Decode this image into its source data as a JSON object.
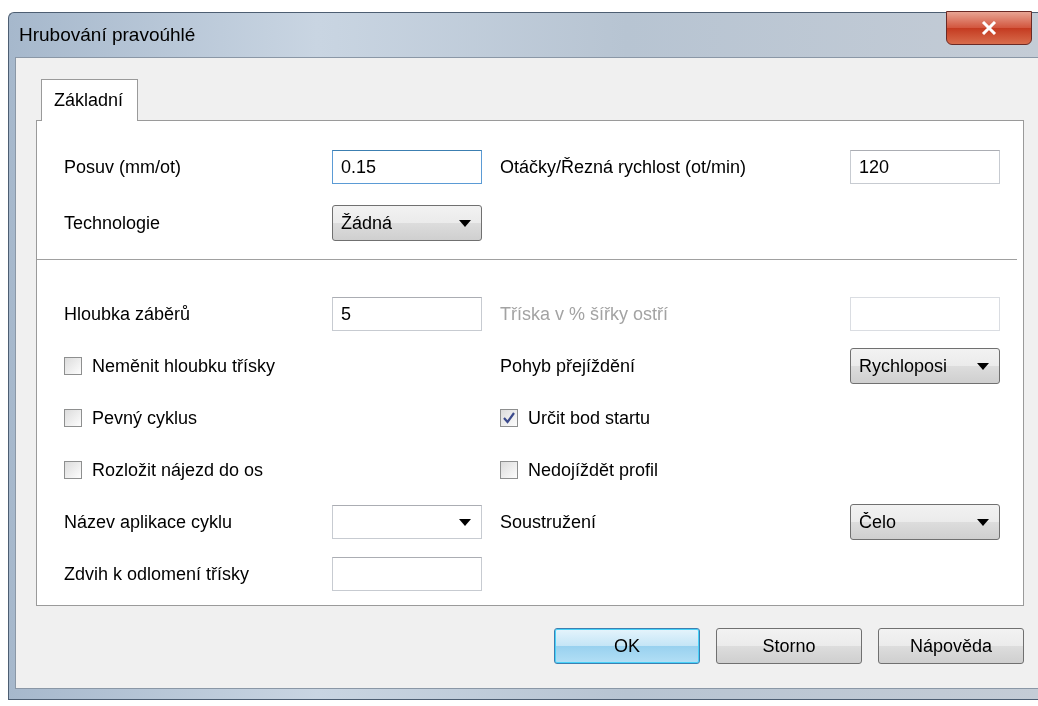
{
  "window": {
    "title": "Hrubování pravoúhlé"
  },
  "tabs": [
    {
      "label": "Základní",
      "selected": true
    }
  ],
  "sections": [
    {
      "rows": [
        [
          {
            "kind": "text",
            "label": "Posuv (mm/ot)",
            "value": "0.15",
            "focused": true,
            "disabled": false
          },
          {
            "kind": "text",
            "label": "Otáčky/Řezná rychlost (ot/min)",
            "value": "120",
            "focused": false,
            "disabled": false
          }
        ],
        [
          {
            "kind": "dropdown",
            "label": "Technologie",
            "value": "Žádná",
            "editable": false
          }
        ]
      ]
    },
    {
      "rows": [
        [
          {
            "kind": "text",
            "label": "Hloubka záběrů",
            "value": "5",
            "focused": false,
            "disabled": false
          },
          {
            "kind": "text",
            "label": "Tříska v % šířky ostří",
            "focused": false,
            "disabled": true
          }
        ],
        [
          {
            "kind": "checkbox",
            "label": "Neměnit hloubku třísky",
            "checked": false
          },
          {
            "kind": "dropdown",
            "label": "Pohyb přejíždění",
            "value": "Rychloposi",
            "editable": false
          }
        ],
        [
          {
            "kind": "checkbox",
            "label": "Pevný cyklus",
            "checked": false
          },
          {
            "kind": "checkbox",
            "label": "Určit bod startu",
            "checked": true
          }
        ],
        [
          {
            "kind": "checkbox",
            "label": "Rozložit nájezd do os",
            "checked": false
          },
          {
            "kind": "checkbox",
            "label": "Nedojíždět profil",
            "checked": false
          }
        ],
        [
          {
            "kind": "dropdown",
            "label": "Název aplikace cyklu",
            "editable": true
          },
          {
            "kind": "dropdown",
            "label": "Soustružení",
            "value": "Čelo",
            "editable": false
          }
        ],
        [
          {
            "kind": "text",
            "label": "Zdvih k odlomení třísky",
            "focused": false,
            "disabled": false
          }
        ]
      ]
    }
  ],
  "buttons": [
    {
      "label": "OK",
      "default": true
    },
    {
      "label": "Storno",
      "default": false
    },
    {
      "label": "Nápověda",
      "default": false
    }
  ]
}
